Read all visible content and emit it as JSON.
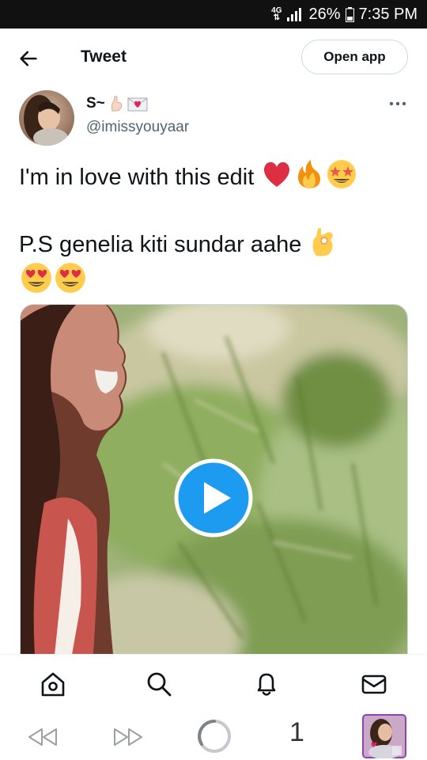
{
  "status_bar": {
    "network": "4G",
    "battery": "26%",
    "time": "7:35 PM"
  },
  "header": {
    "title": "Tweet",
    "open_app_label": "Open app"
  },
  "tweet": {
    "display_name": "S~",
    "handle": "@imissyouyaar",
    "line1": "I'm in love with this edit",
    "line2": "P.S genelia kiti sundar aahe",
    "emojis_line1": [
      "red-heart",
      "fire",
      "star-struck"
    ],
    "emojis_line2": [
      "ok-hand",
      "heart-eyes",
      "heart-eyes"
    ]
  },
  "bottom_nav": {
    "items": [
      "home-icon",
      "search-icon",
      "notifications-icon",
      "messages-icon"
    ]
  },
  "browser_bar": {
    "tab_count": "1"
  },
  "colors": {
    "accent": "#1d9bf0",
    "text": "#0f1419",
    "secondary": "#536471"
  }
}
